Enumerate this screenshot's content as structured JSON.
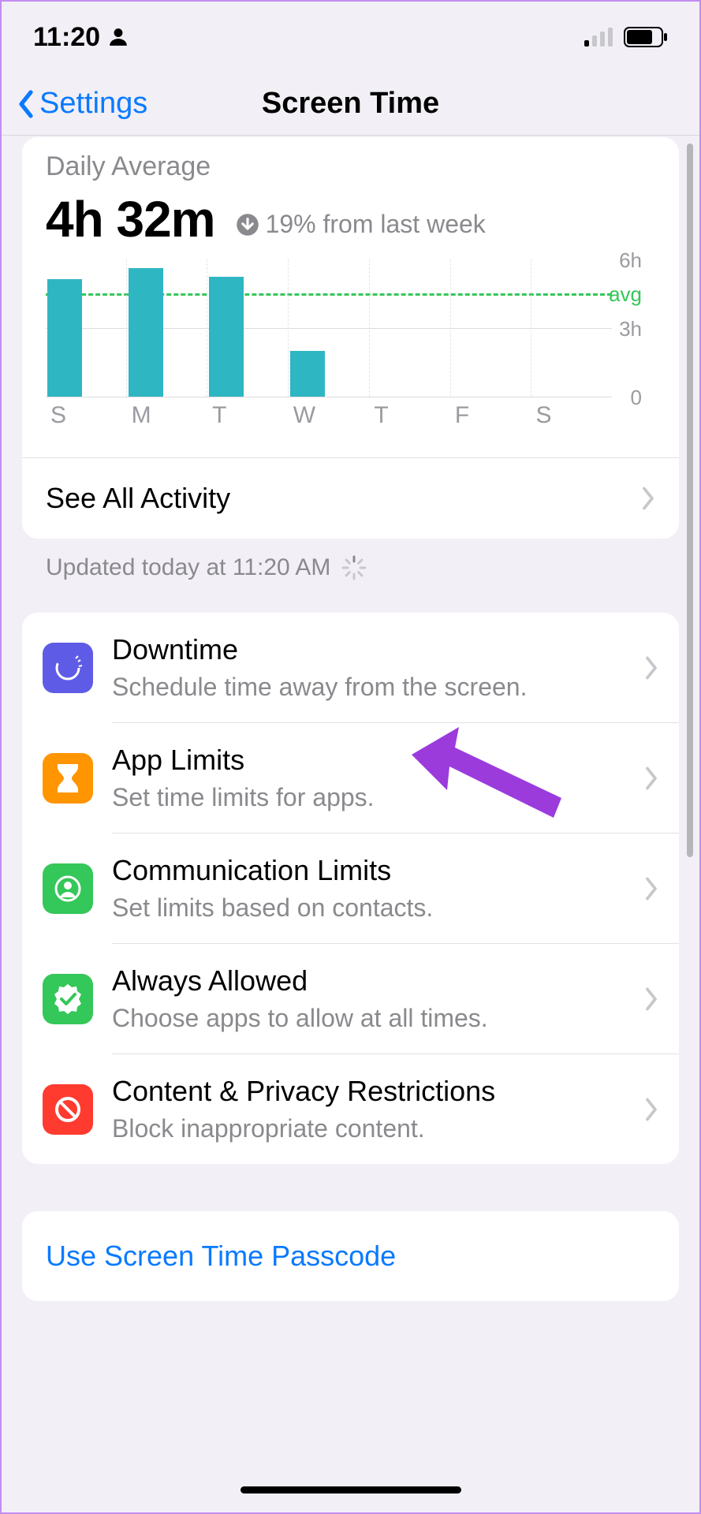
{
  "status": {
    "time": "11:20"
  },
  "nav": {
    "back_label": "Settings",
    "title": "Screen Time"
  },
  "summary": {
    "daily_average_label": "Daily Average",
    "daily_average_value": "4h 32m",
    "delta_text": "19% from last week",
    "see_all_label": "See All Activity",
    "updated_text": "Updated today at 11:20 AM"
  },
  "chart_data": {
    "type": "bar",
    "categories": [
      "S",
      "M",
      "T",
      "W",
      "T",
      "F",
      "S"
    ],
    "values": [
      5.1,
      5.6,
      5.2,
      2.0,
      0,
      0,
      0
    ],
    "avg_line_value": 4.53,
    "ylim": [
      0,
      6
    ],
    "ylabel": "",
    "xlabel": "",
    "title": "",
    "ticks": [
      {
        "label": "6h",
        "value": 6
      },
      {
        "label": "avg",
        "value": 4.53,
        "avg": true
      },
      {
        "label": "3h",
        "value": 3
      },
      {
        "label": "0",
        "value": 0
      }
    ]
  },
  "settings": {
    "items": [
      {
        "title": "Downtime",
        "subtitle": "Schedule time away from the screen.",
        "icon": "downtime",
        "color": "#5e5ce6"
      },
      {
        "title": "App Limits",
        "subtitle": "Set time limits for apps.",
        "icon": "hourglass",
        "color": "#ff9500"
      },
      {
        "title": "Communication Limits",
        "subtitle": "Set limits based on contacts.",
        "icon": "contact",
        "color": "#34c759"
      },
      {
        "title": "Always Allowed",
        "subtitle": "Choose apps to allow at all times.",
        "icon": "check-seal",
        "color": "#34c759"
      },
      {
        "title": "Content & Privacy Restrictions",
        "subtitle": "Block inappropriate content.",
        "icon": "no-entry",
        "color": "#ff3b30"
      }
    ]
  },
  "passcode": {
    "label": "Use Screen Time Passcode"
  }
}
